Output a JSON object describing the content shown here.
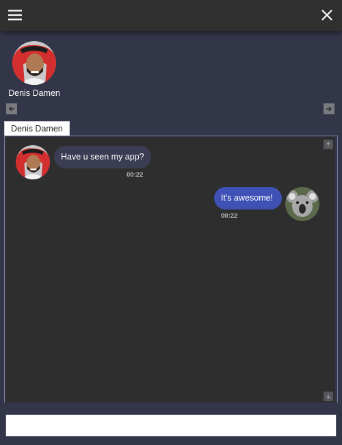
{
  "header": {
    "menu_icon": "hamburger-menu-icon",
    "close_icon": "close-icon"
  },
  "contacts": [
    {
      "name": "Denis Damen",
      "avatar": "man-in-red-keffiyeh-avatar"
    }
  ],
  "carousel": {
    "prev_icon": "arrow-left-icon",
    "next_icon": "arrow-right-icon"
  },
  "chat": {
    "tab_label": "Denis Damen",
    "scroll_up_icon": "arrow-up-icon",
    "scroll_down_icon": "arrow-down-icon",
    "messages": [
      {
        "direction": "incoming",
        "text": "Have u seen my app?",
        "time": "00:22",
        "avatar": "man-in-red-keffiyeh-avatar"
      },
      {
        "direction": "outgoing",
        "text": "It's awesome!",
        "time": "00:22",
        "avatar": "koala-avatar"
      }
    ]
  },
  "composer": {
    "value": "",
    "placeholder": ""
  },
  "colors": {
    "background": "#333648",
    "topbar": "#303030",
    "chat_background": "#2e2e2e",
    "incoming_bubble": "#3a3d53",
    "outgoing_bubble": "#3f51b5",
    "tab_background": "#ffffff"
  }
}
